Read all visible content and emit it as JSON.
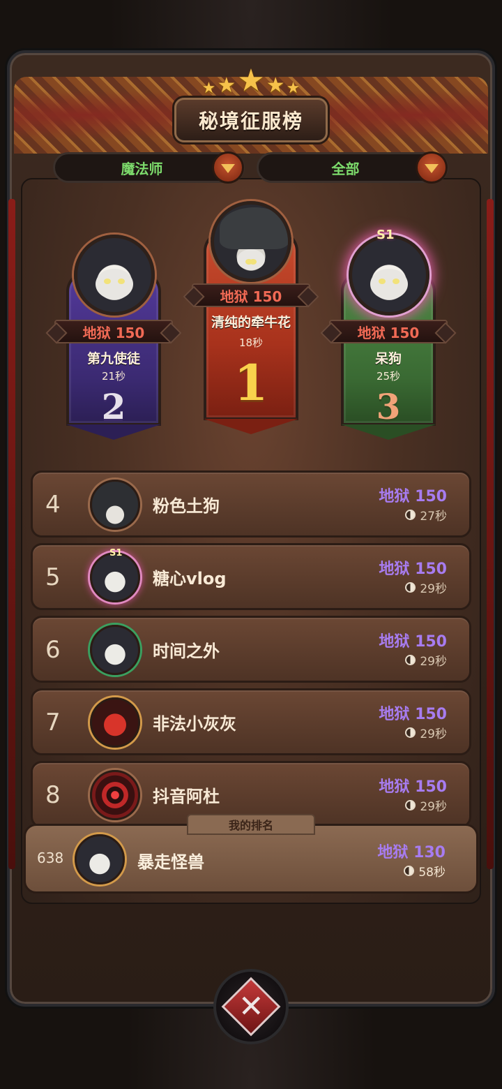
{
  "title": "秘境征服榜",
  "filters": {
    "class": "魔法师",
    "scope": "全部"
  },
  "podium": {
    "first": {
      "rank_number": "1",
      "difficulty": "地狱 150",
      "name": "清纯的牵牛花",
      "time": "18秒"
    },
    "second": {
      "rank_number": "2",
      "difficulty": "地狱 150",
      "name": "第九使徒",
      "time": "21秒"
    },
    "third": {
      "rank_number": "3",
      "difficulty": "地狱 150",
      "name": "呆狗",
      "time": "25秒",
      "badge": "S1"
    }
  },
  "rows": [
    {
      "rank": "4",
      "name": "粉色土狗",
      "difficulty": "地狱 150",
      "time": "27秒"
    },
    {
      "rank": "5",
      "name": "糖心vlog",
      "difficulty": "地狱 150",
      "time": "29秒",
      "badge": "S1"
    },
    {
      "rank": "6",
      "name": "时间之外",
      "difficulty": "地狱 150",
      "time": "29秒"
    },
    {
      "rank": "7",
      "name": "非法小灰灰",
      "difficulty": "地狱 150",
      "time": "29秒"
    },
    {
      "rank": "8",
      "name": "抖音阿杜",
      "difficulty": "地狱 150",
      "time": "29秒"
    }
  ],
  "my_rank": {
    "label": "我的排名",
    "rank": "638",
    "name": "暴走怪兽",
    "difficulty": "地狱 130",
    "time": "58秒"
  },
  "colors": {
    "difficulty_purple": "#a77cf0",
    "difficulty_red": "#f16a55",
    "filter_green": "#7ddb6c",
    "gold": "#f9d24c"
  },
  "icons": {
    "filter_dropdown": "chevron-down-icon",
    "close": "close-icon",
    "time": "clock-icon"
  }
}
